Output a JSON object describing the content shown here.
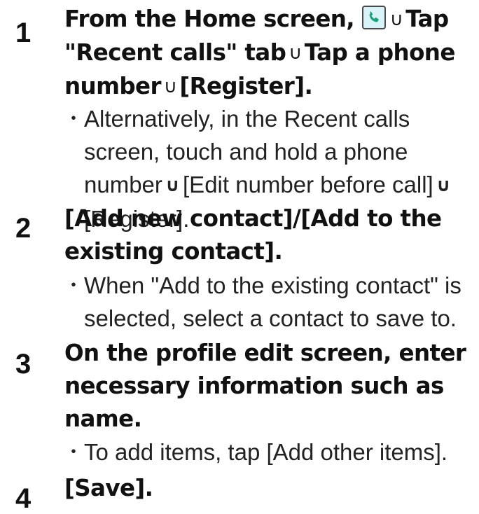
{
  "steps": [
    {
      "number": "1",
      "title_parts": [
        "From the Home screen, ",
        "Tap \"Recent calls\" tab",
        "Tap a phone number",
        "[Register]."
      ],
      "note_parts": [
        "Alternatively, in the Recent calls screen, touch and hold a phone number",
        "[Edit number before call]",
        "[Register]."
      ]
    },
    {
      "number": "2",
      "title": "[Add new contact]/[Add to the existing contact].",
      "note": "When \"Add to the existing contact\" is selected, select a contact to save to."
    },
    {
      "number": "3",
      "title": "On the profile edit screen, enter necessary information such as name.",
      "note": "To add items, tap [Add other items]."
    },
    {
      "number": "4",
      "title": "[Save]."
    }
  ],
  "symbols": {
    "arrow": "∪",
    "bullet": "･"
  },
  "icons": {
    "phone": "phone-app-icon"
  },
  "colors": {
    "icon_bg": "#d8f4f8",
    "icon_handset": "#1aa37a",
    "text": "#111111"
  }
}
